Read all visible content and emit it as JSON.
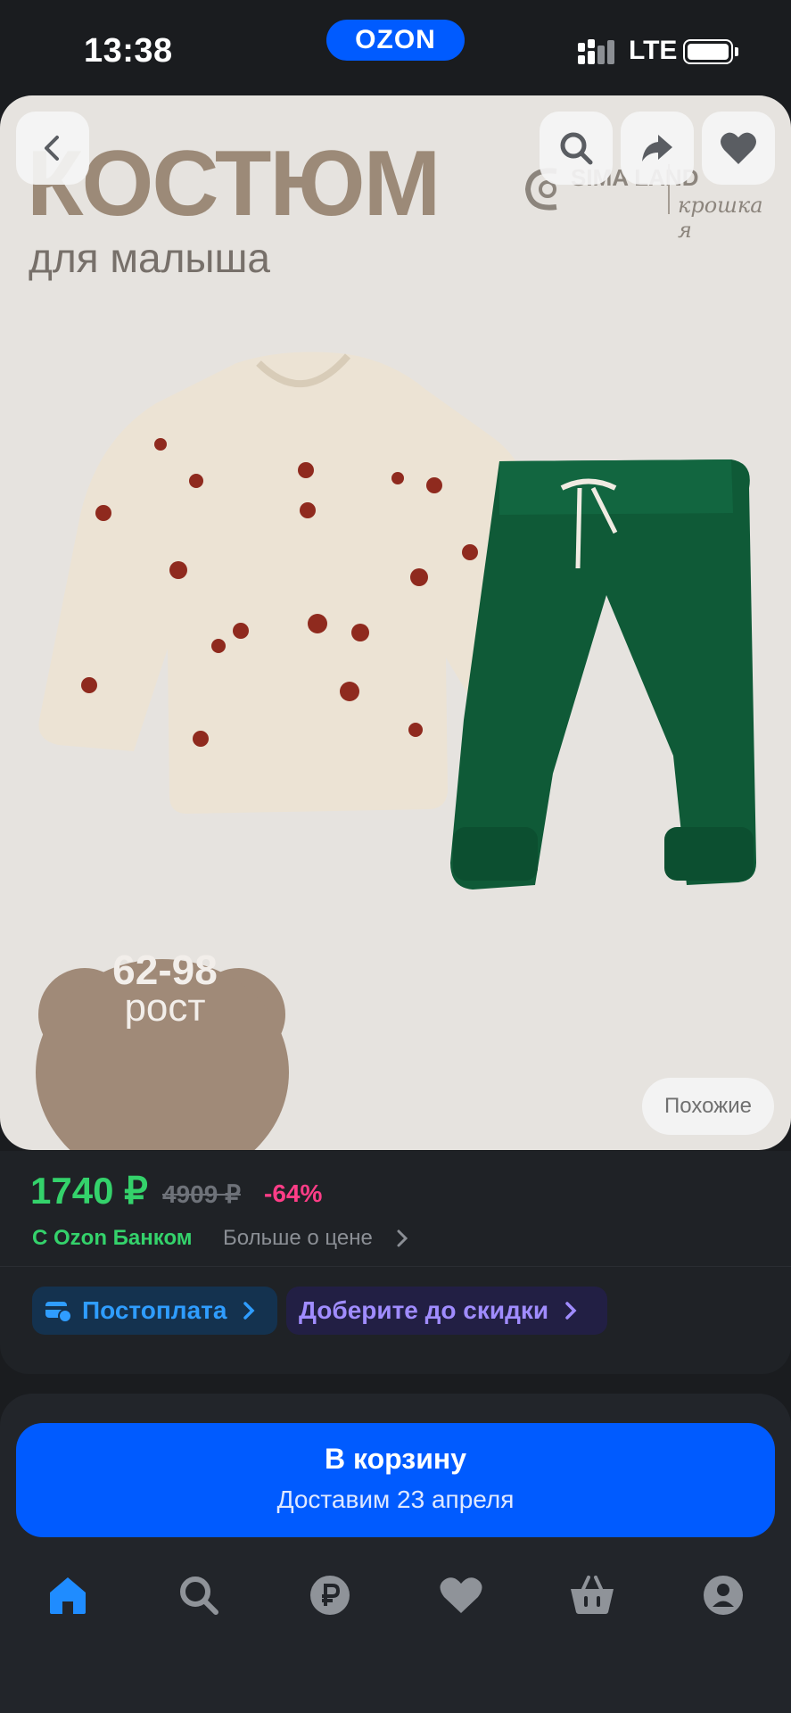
{
  "status_bar": {
    "time": "13:38",
    "app_pill": "OZON",
    "network": "LTE"
  },
  "product_image": {
    "headline": "КОСТЮМ",
    "subheadline": "для малыша",
    "brand_line": "SIMA LAND",
    "brand_sub": "крошка я",
    "size_range": "62-98",
    "size_label": "рост",
    "similar_button": "Похожие"
  },
  "top_actions": {
    "back_icon": "chevron-left-icon",
    "search_icon": "search-icon",
    "share_icon": "share-icon",
    "favorite_icon": "heart-icon"
  },
  "pricing": {
    "price": "1740 ₽",
    "old_price": "4909 ₽",
    "discount": "-64%",
    "bank_label": "С Ozon Банком",
    "more_price_label": "Больше о цене"
  },
  "chips": {
    "postpay": "Постоплата",
    "add_for_discount": "Доберите до скидки"
  },
  "cart": {
    "title": "В корзину",
    "delivery": "Доставим 23 апреля"
  },
  "tab_bar": {
    "items": [
      {
        "icon": "home-icon",
        "active": true
      },
      {
        "icon": "search-icon",
        "active": false
      },
      {
        "icon": "ruble-icon",
        "active": false
      },
      {
        "icon": "heart-icon",
        "active": false
      },
      {
        "icon": "basket-icon",
        "active": false
      },
      {
        "icon": "profile-icon",
        "active": false
      }
    ]
  },
  "colors": {
    "accent_blue": "#005bff",
    "price_green": "#34d26b",
    "discount_pink": "#ff3d87",
    "pants_green": "#0f5a37"
  }
}
